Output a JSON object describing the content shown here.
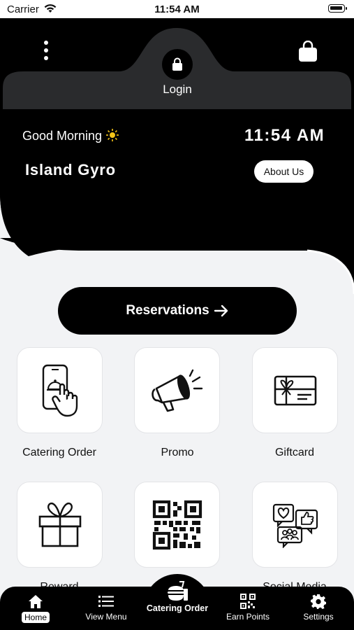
{
  "status_bar": {
    "carrier": "Carrier",
    "time": "11:54 AM"
  },
  "header": {
    "login_label": "Login",
    "greeting": "Good Morning",
    "clock": "11:54 AM",
    "restaurant_name": "Island Gyro",
    "about_label": "About Us"
  },
  "reservations": {
    "label": "Reservations"
  },
  "tiles": [
    {
      "label": "Catering Order",
      "icon": "phone-tap-icon"
    },
    {
      "label": "Promo",
      "icon": "megaphone-icon"
    },
    {
      "label": "Giftcard",
      "icon": "giftcard-icon"
    },
    {
      "label": "Reward",
      "icon": "gift-box-icon"
    },
    {
      "label": "",
      "icon": "qr-code-icon"
    },
    {
      "label": "Social Media",
      "icon": "social-media-icon"
    }
  ],
  "tabbar": {
    "home": "Home",
    "view_menu": "View Menu",
    "catering_order": "Catering Order",
    "earn_points": "Earn Points",
    "settings": "Settings"
  },
  "colors": {
    "primary": "#000000",
    "background": "#f2f3f5",
    "tile": "#ffffff",
    "accent_sun": "#f5c518"
  }
}
